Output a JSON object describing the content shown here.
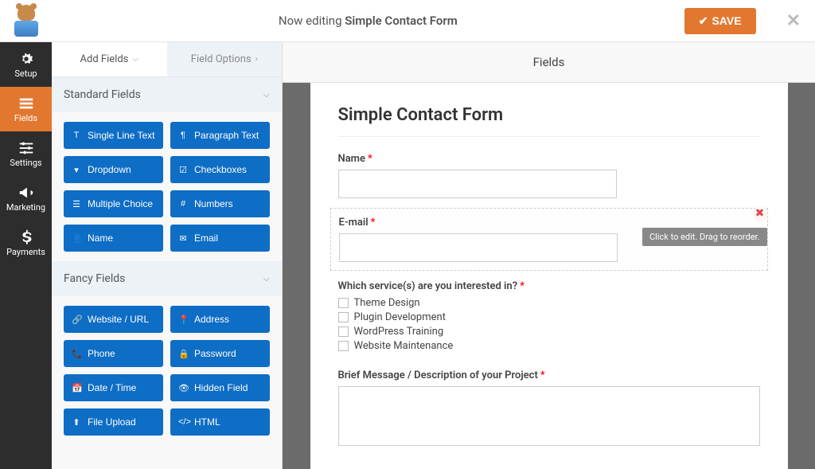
{
  "header": {
    "editing_prefix": "Now editing ",
    "editing_title": "Simple Contact Form",
    "save_label": "SAVE"
  },
  "nav": {
    "items": [
      {
        "key": "setup",
        "label": "Setup",
        "icon": "gear-icon"
      },
      {
        "key": "fields",
        "label": "Fields",
        "icon": "list-icon",
        "active": true
      },
      {
        "key": "settings",
        "label": "Settings",
        "icon": "sliders-icon"
      },
      {
        "key": "marketing",
        "label": "Marketing",
        "icon": "bullhorn-icon"
      },
      {
        "key": "payments",
        "label": "Payments",
        "icon": "dollar-icon"
      }
    ]
  },
  "left_panel": {
    "tabs": [
      {
        "label": "Add Fields",
        "active": true
      },
      {
        "label": "Field Options",
        "active": false
      }
    ],
    "sections": [
      {
        "title": "Standard Fields",
        "fields": [
          {
            "label": "Single Line Text",
            "icon": "text-icon"
          },
          {
            "label": "Paragraph Text",
            "icon": "paragraph-icon"
          },
          {
            "label": "Dropdown",
            "icon": "dropdown-icon"
          },
          {
            "label": "Checkboxes",
            "icon": "checkbox-icon"
          },
          {
            "label": "Multiple Choice",
            "icon": "radio-icon"
          },
          {
            "label": "Numbers",
            "icon": "hash-icon"
          },
          {
            "label": "Name",
            "icon": "user-icon"
          },
          {
            "label": "Email",
            "icon": "envelope-icon"
          }
        ]
      },
      {
        "title": "Fancy Fields",
        "fields": [
          {
            "label": "Website / URL",
            "icon": "link-icon"
          },
          {
            "label": "Address",
            "icon": "pin-icon"
          },
          {
            "label": "Phone",
            "icon": "phone-icon"
          },
          {
            "label": "Password",
            "icon": "lock-icon"
          },
          {
            "label": "Date / Time",
            "icon": "calendar-icon"
          },
          {
            "label": "Hidden Field",
            "icon": "eye-icon"
          },
          {
            "label": "File Upload",
            "icon": "upload-icon"
          },
          {
            "label": "HTML",
            "icon": "code-icon"
          }
        ]
      }
    ]
  },
  "center_name": "Fields",
  "form": {
    "title": "Simple Contact Form",
    "helper": "Click to edit. Drag to reorder.",
    "fields": [
      {
        "type": "text",
        "label": "Name",
        "required": true
      },
      {
        "type": "text",
        "label": "E-mail",
        "required": true,
        "selected": true
      },
      {
        "type": "checkboxes",
        "label": "Which service(s) are you interested in?",
        "required": true,
        "options": [
          "Theme Design",
          "Plugin Development",
          "WordPress Training",
          "Website Maintenance"
        ]
      },
      {
        "type": "textarea",
        "label": "Brief Message / Description of your Project",
        "required": true
      }
    ]
  }
}
